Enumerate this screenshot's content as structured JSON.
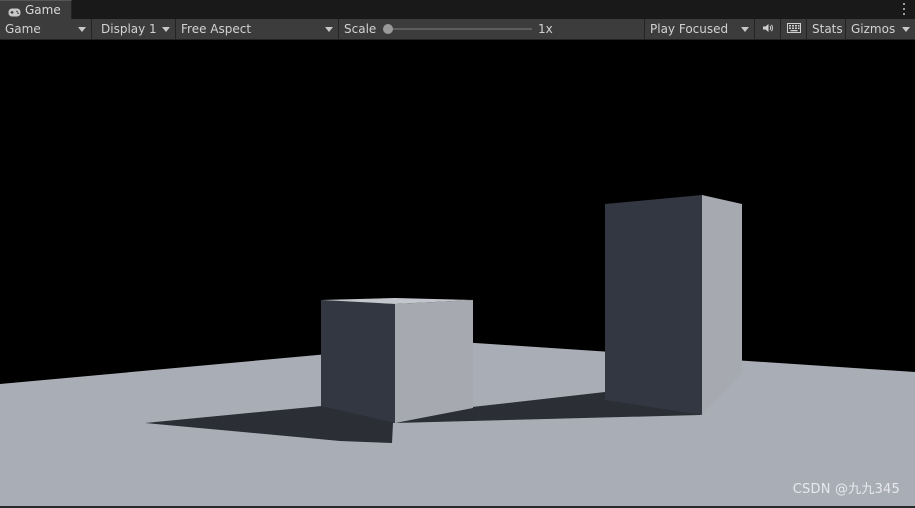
{
  "window": {
    "tab_label": "Game",
    "tab_icon": "gamepad-icon",
    "menu_icon": "kebab-menu-icon"
  },
  "toolbar": {
    "view_dropdown": "Game",
    "display_dropdown": "Display 1",
    "aspect_dropdown": "Free Aspect",
    "scale_label": "Scale",
    "scale_value": "1x",
    "scale_slider_fraction": 0.0,
    "play_mode_dropdown": "Play Focused",
    "audio_icon": "speaker-icon",
    "keyboard_icon": "keyboard-icon",
    "stats_button": "Stats",
    "gizmos_button": "Gizmos"
  },
  "scene": {
    "sky_color": "#000000",
    "ground_color": "#a9adb5",
    "shadow_color": "#2b2e35",
    "cube_dark_color": "#323741",
    "cube_light_color": "#a6a9b0"
  },
  "watermark": "CSDN @九九345"
}
